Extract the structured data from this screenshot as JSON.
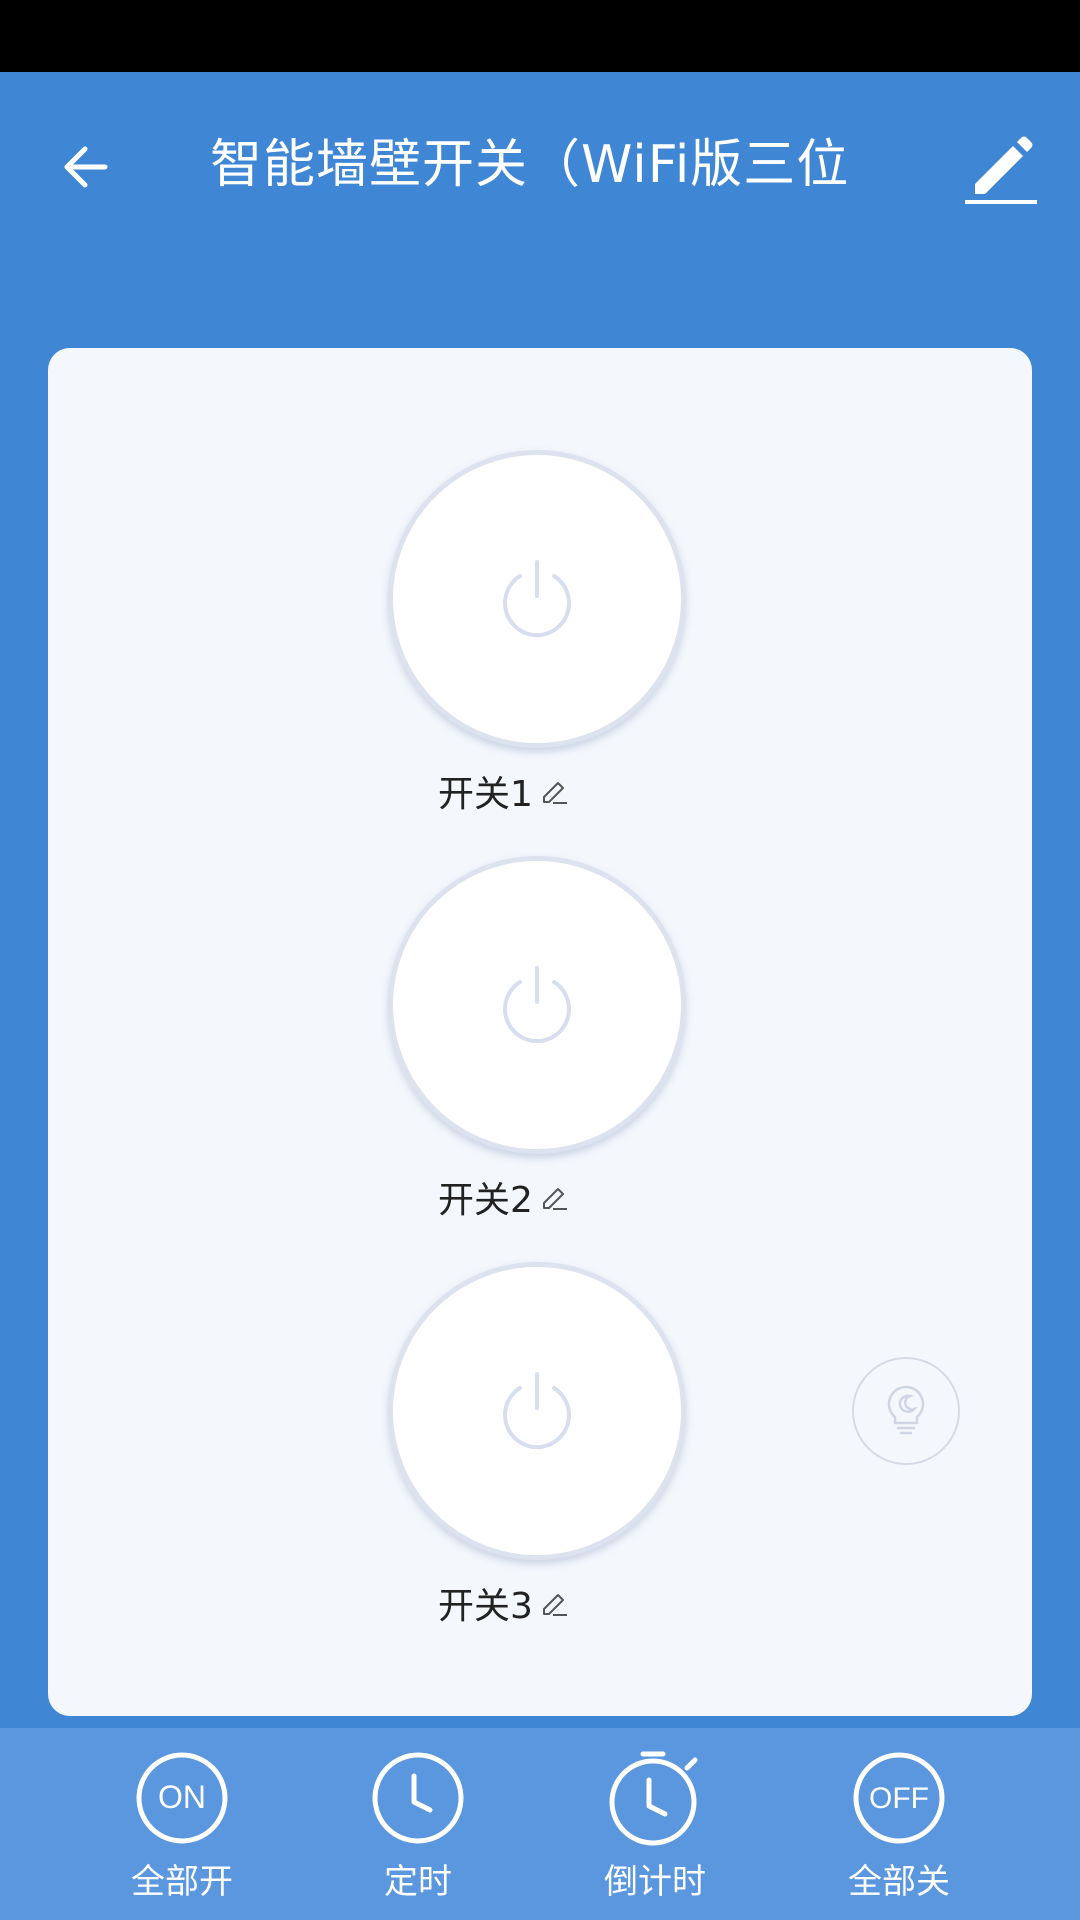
{
  "header": {
    "title": "智能墙壁开关（WiFi版三位",
    "back_icon": "arrow-left-icon",
    "edit_icon": "pencil-icon"
  },
  "switches": [
    {
      "label": "开关1",
      "icon": "power-icon",
      "state": "off"
    },
    {
      "label": "开关2",
      "icon": "power-icon",
      "state": "off"
    },
    {
      "label": "开关3",
      "icon": "power-icon",
      "state": "off"
    }
  ],
  "scene_button": {
    "icon": "bulb-moon-icon"
  },
  "toolbar": [
    {
      "label": "全部开",
      "icon": "on-circle-icon",
      "icon_text": "ON"
    },
    {
      "label": "定时",
      "icon": "clock-icon"
    },
    {
      "label": "倒计时",
      "icon": "stopwatch-icon"
    },
    {
      "label": "全部关",
      "icon": "off-circle-icon",
      "icon_text": "OFF"
    }
  ],
  "colors": {
    "primary": "#3f87d5",
    "toolbar": "#5a97de",
    "card": "#f4f8fd",
    "button_ring": "#dde2ef"
  }
}
